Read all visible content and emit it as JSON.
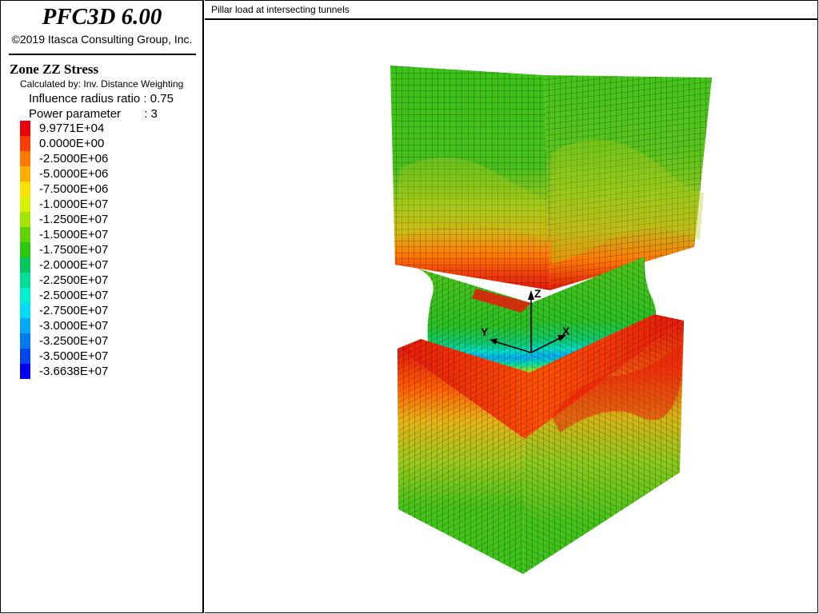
{
  "app": {
    "title": "PFC3D 6.00",
    "copyright": "©2019 Itasca Consulting Group, Inc."
  },
  "view": {
    "title": "Pillar load at intersecting tunnels"
  },
  "legend": {
    "title": "Zone ZZ Stress",
    "calculated_by": "Calculated by: Inv. Distance Weighting",
    "influence_label": "Influence radius ratio : 0.75",
    "power_label": "Power parameter       : 3",
    "entries": [
      {
        "label": "9.9771E+04",
        "color": "#e8000b"
      },
      {
        "label": "0.0000E+00",
        "color": "#ff3c00"
      },
      {
        "label": "-2.5000E+06",
        "color": "#ff7a00"
      },
      {
        "label": "-5.0000E+06",
        "color": "#ffae00"
      },
      {
        "label": "-7.5000E+06",
        "color": "#ffe100"
      },
      {
        "label": "-1.0000E+07",
        "color": "#d7f000"
      },
      {
        "label": "-1.2500E+07",
        "color": "#a0e600"
      },
      {
        "label": "-1.5000E+07",
        "color": "#5fd400"
      },
      {
        "label": "-1.7500E+07",
        "color": "#2ac80a"
      },
      {
        "label": "-2.0000E+07",
        "color": "#00c85a"
      },
      {
        "label": "-2.2500E+07",
        "color": "#00dc96"
      },
      {
        "label": "-2.5000E+07",
        "color": "#00f0d2"
      },
      {
        "label": "-2.7500E+07",
        "color": "#00dcf5"
      },
      {
        "label": "-3.0000E+07",
        "color": "#00aaf5"
      },
      {
        "label": "-3.2500E+07",
        "color": "#0078f0"
      },
      {
        "label": "-3.5000E+07",
        "color": "#0046eb"
      },
      {
        "label": "-3.6638E+07",
        "color": "#0000f0"
      }
    ]
  },
  "axes": {
    "z_label": "Z",
    "x_label": "X",
    "y_label": "Y"
  }
}
